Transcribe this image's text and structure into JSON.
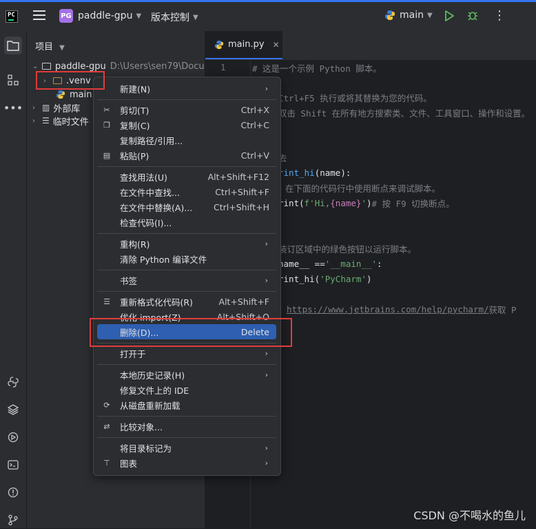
{
  "titlebar": {
    "app_logo": "PC",
    "project_badge": "PG",
    "project_name": "paddle-gpu",
    "vcs_menu": "版本控制",
    "branch": "main"
  },
  "project_panel": {
    "title": "项目",
    "tree": [
      {
        "label": "paddle-gpu",
        "path": "D:\\Users\\sen79\\Docu"
      },
      {
        "label": ".venv"
      },
      {
        "label": "main.py"
      },
      {
        "label": "外部库"
      },
      {
        "label": "临时文件"
      }
    ]
  },
  "editor": {
    "tab": "main.py",
    "line_number": "1",
    "lines": [
      "# 这是一个示例 Python 脚本。",
      "Ctrl+F5 执行或将其替换为您的代码。",
      "双击 Shift 在所有地方搜索类、文件、工具窗口、操作和设置。",
      "去",
      "rint_hi",
      "(name):",
      "在下面的代码行中使用断点来调试脚本。",
      "rint(",
      "f'Hi, ",
      "{name}",
      "'",
      ")  ",
      "# 按 F9 切换断点。",
      "装订区域中的绿色按钮以运行脚本。",
      "name__ == ",
      "'__main__'",
      ":",
      "rint_hi(",
      "'PyCharm'",
      ")",
      "https://www.jetbrains.com/help/pycharm/",
      " 获取 P"
    ]
  },
  "context_menu": {
    "items": [
      {
        "label": "新建(N)",
        "shortcut": ""
      },
      {
        "label": "剪切(T)",
        "shortcut": "Ctrl+X"
      },
      {
        "label": "复制(C)",
        "shortcut": "Ctrl+C"
      },
      {
        "label": "复制路径/引用...",
        "shortcut": ""
      },
      {
        "label": "粘贴(P)",
        "shortcut": "Ctrl+V"
      },
      {
        "label": "查找用法(U)",
        "shortcut": "Alt+Shift+F12"
      },
      {
        "label": "在文件中查找...",
        "shortcut": "Ctrl+Shift+F"
      },
      {
        "label": "在文件中替换(A)...",
        "shortcut": "Ctrl+Shift+H"
      },
      {
        "label": "检查代码(I)...",
        "shortcut": ""
      },
      {
        "label": "重构(R)",
        "shortcut": ""
      },
      {
        "label": "清除 Python 编译文件",
        "shortcut": ""
      },
      {
        "label": "书签",
        "shortcut": ""
      },
      {
        "label": "重新格式化代码(R)",
        "shortcut": "Alt+Shift+F"
      },
      {
        "label": "优化 import(Z)",
        "shortcut": "Alt+Shift+O"
      },
      {
        "label": "删除(D)...",
        "shortcut": "Delete"
      },
      {
        "label": "打开于",
        "shortcut": ""
      },
      {
        "label": "本地历史记录(H)",
        "shortcut": ""
      },
      {
        "label": "修复文件上的 IDE",
        "shortcut": ""
      },
      {
        "label": "从磁盘重新加载",
        "shortcut": ""
      },
      {
        "label": "比较对象...",
        "shortcut": ""
      },
      {
        "label": "将目录标记为",
        "shortcut": ""
      },
      {
        "label": "图表",
        "shortcut": ""
      }
    ]
  },
  "watermark": "CSDN @不喝水的鱼儿",
  "colors": {
    "accent": "#3574f0",
    "selection": "#2e5fb0",
    "highlight_box": "#e23b3b"
  }
}
